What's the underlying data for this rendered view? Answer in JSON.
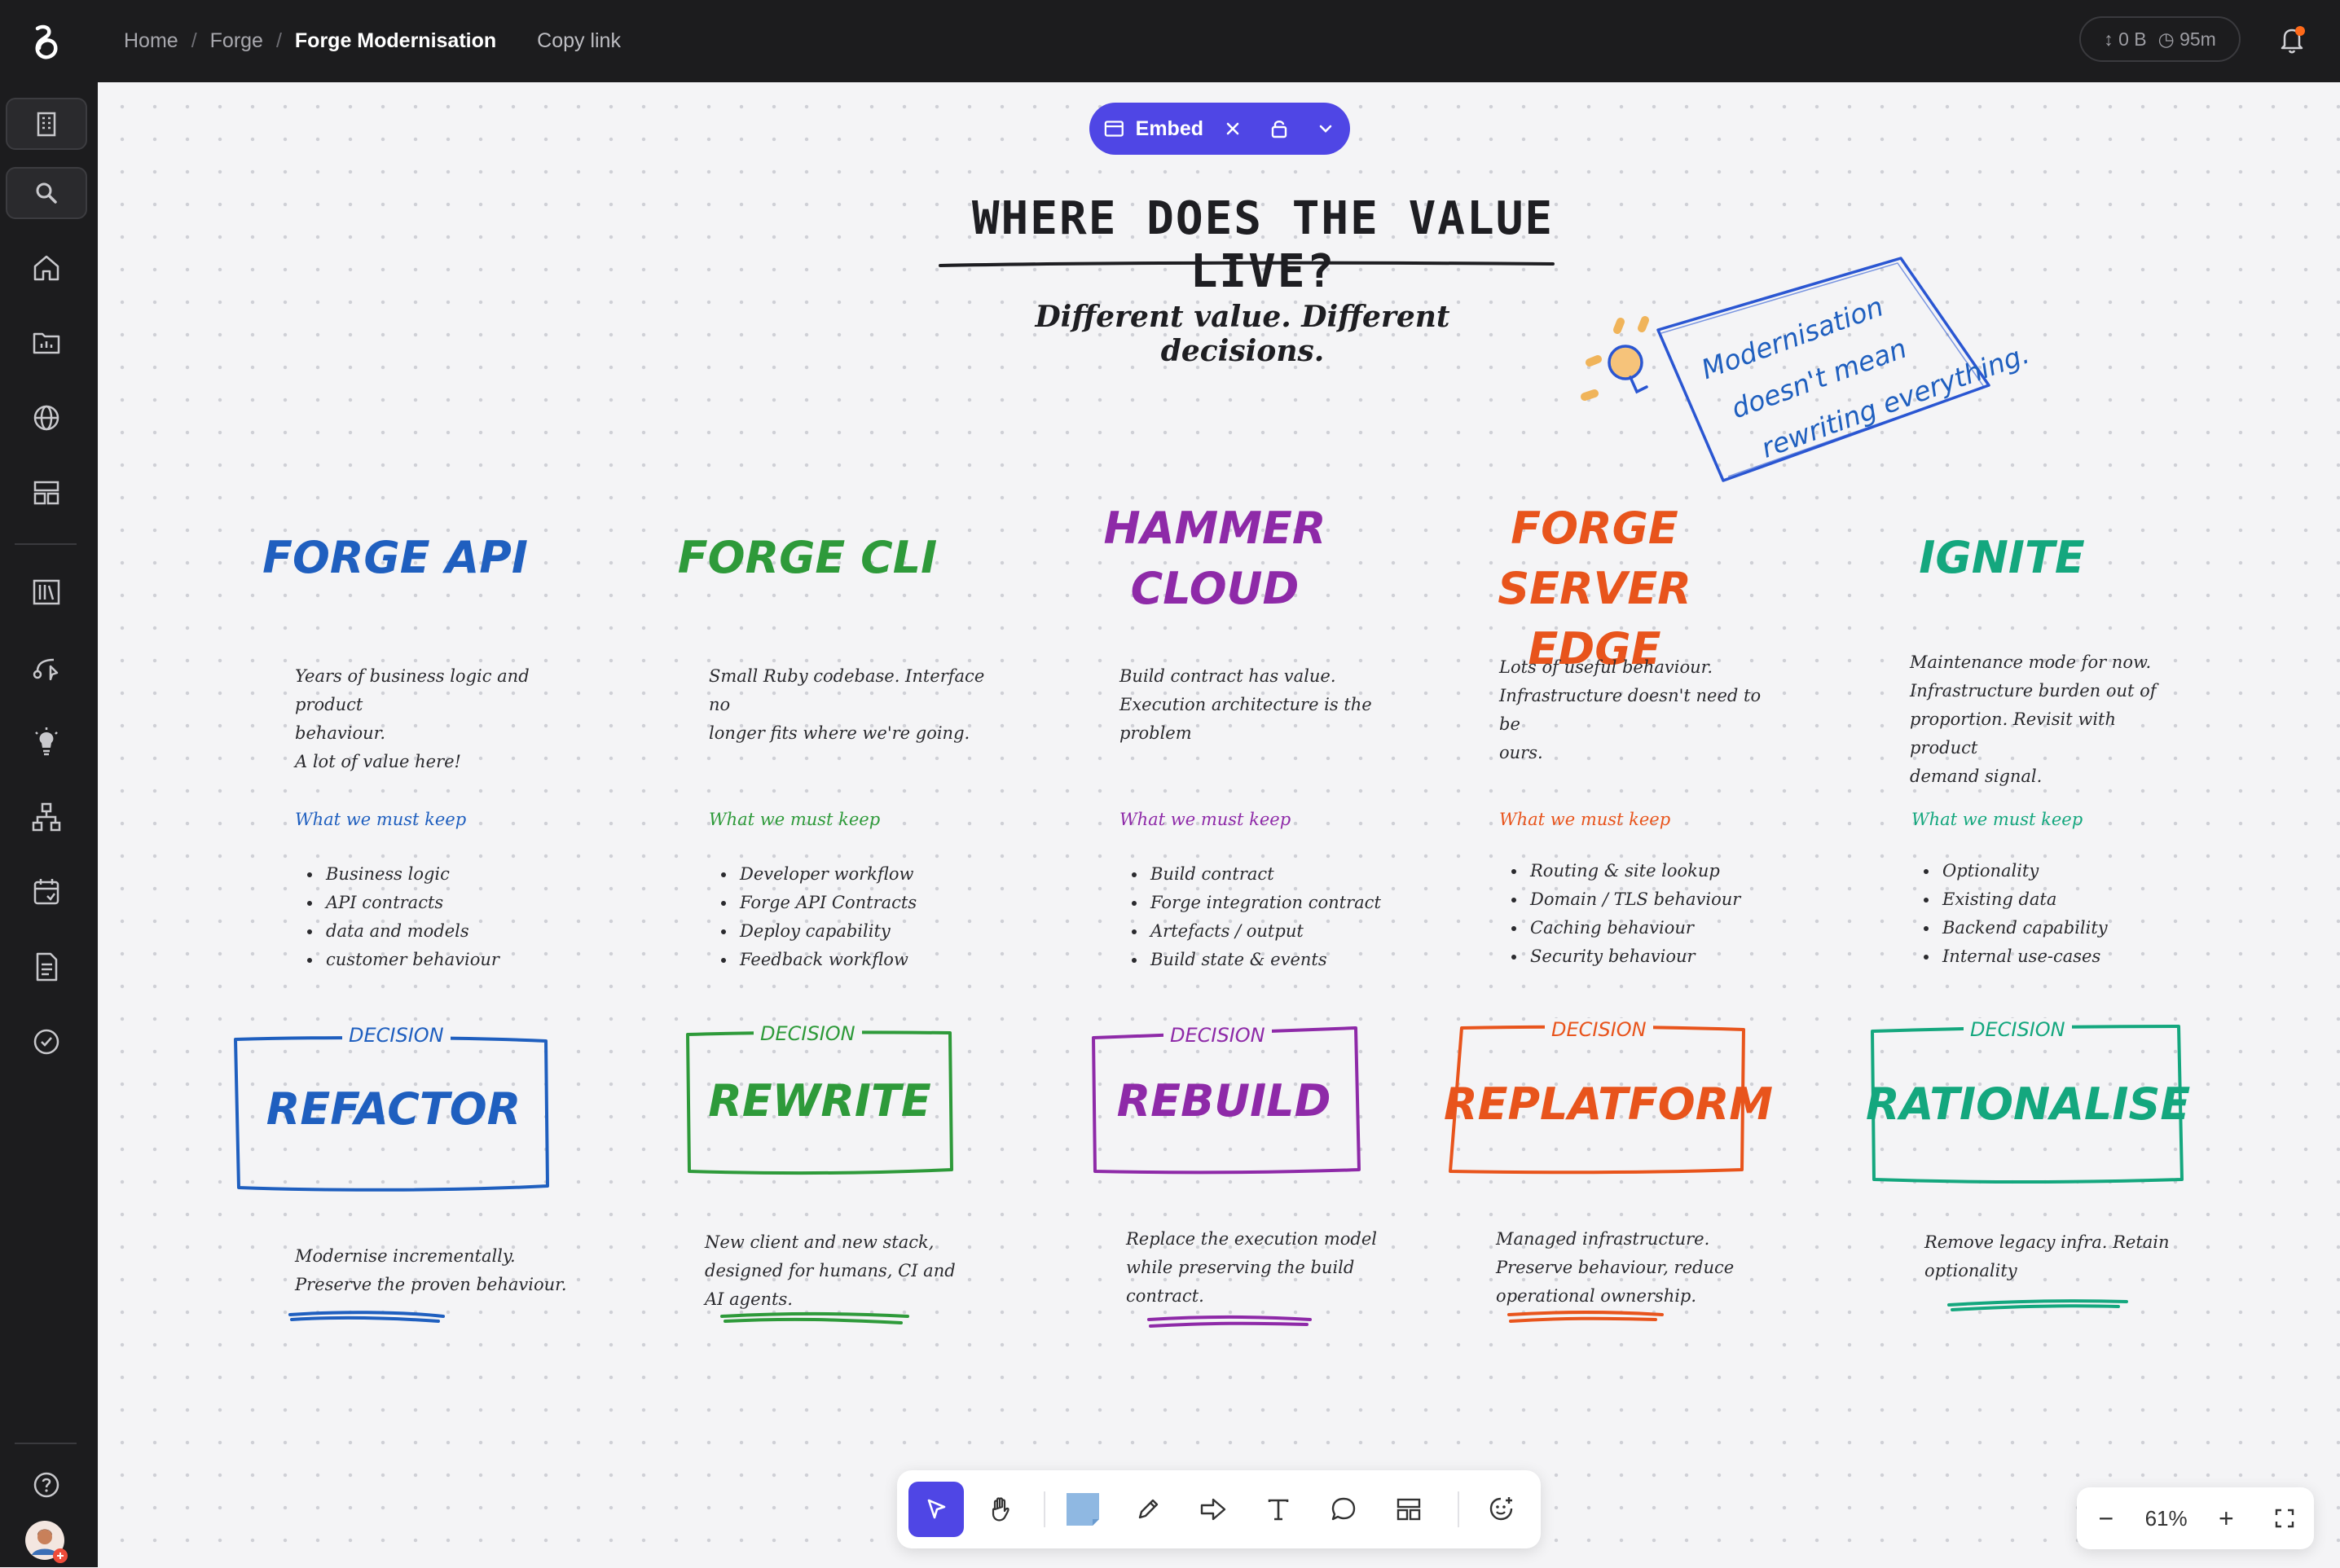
{
  "breadcrumb": {
    "home": "Home",
    "forge": "Forge",
    "current": "Forge Modernisation",
    "copy_link": "Copy link"
  },
  "stats": {
    "size": "0 B",
    "time": "95m"
  },
  "embed": {
    "label": "Embed"
  },
  "board": {
    "title": "WHERE DOES THE VALUE LIVE?",
    "subtitle": "Different value. Different decisions.",
    "note": [
      "Modernisation",
      "doesn't mean",
      "rewriting everything."
    ],
    "keep_label": "What we must keep",
    "decision_label": "DECISION"
  },
  "columns": [
    {
      "title": [
        "FORGE API"
      ],
      "color": "#1f5fbf",
      "desc": [
        "Years of business logic and product",
        "behaviour.",
        "A lot of value here!"
      ],
      "keep": [
        "Business logic",
        "API contracts",
        "data and models",
        "customer behaviour"
      ],
      "decision": "REFACTOR",
      "footer": [
        "Modernise incrementally.",
        "Preserve the proven behaviour."
      ]
    },
    {
      "title": [
        "FORGE CLI"
      ],
      "color": "#2e9a3a",
      "desc": [
        "Small Ruby codebase. Interface no",
        "longer fits where we're going."
      ],
      "keep": [
        "Developer workflow",
        "Forge API Contracts",
        "Deploy capability",
        "Feedback workflow"
      ],
      "decision": "REWRITE",
      "footer": [
        "New client and new stack,",
        "designed for humans, CI and",
        "AI agents."
      ]
    },
    {
      "title": [
        "HAMMER",
        "CLOUD"
      ],
      "color": "#8e2aa8",
      "desc": [
        "Build contract has value.",
        "Execution architecture is the",
        "problem"
      ],
      "keep": [
        "Build contract",
        "Forge integration contract",
        "Artefacts / output",
        "Build state & events"
      ],
      "decision": "REBUILD",
      "footer": [
        "Replace the execution model",
        "while preserving the build",
        "contract."
      ]
    },
    {
      "title": [
        "FORGE",
        "SERVER EDGE"
      ],
      "color": "#e8541c",
      "desc": [
        "Lots of useful behaviour.",
        "Infrastructure doesn't need to be",
        "ours."
      ],
      "keep": [
        "Routing & site lookup",
        "Domain / TLS behaviour",
        "Caching behaviour",
        "Security behaviour"
      ],
      "decision": "REPLATFORM",
      "footer": [
        "Managed infrastructure.",
        "Preserve behaviour, reduce",
        "operational ownership."
      ]
    },
    {
      "title": [
        "IGNITE"
      ],
      "color": "#14a77e",
      "desc": [
        "Maintenance mode for now.",
        "Infrastructure burden out of",
        "proportion. Revisit with product",
        "demand signal."
      ],
      "keep": [
        "Optionality",
        "Existing data",
        "Backend capability",
        "Internal use-cases"
      ],
      "decision": "RATIONALISE",
      "footer": [
        "Remove legacy infra. Retain",
        "optionality"
      ]
    }
  ],
  "zoom": {
    "level": "61%",
    "minus": "−",
    "plus": "+"
  },
  "icons": {
    "sidebar": [
      "building-icon",
      "search-icon",
      "home-icon",
      "folder-icon",
      "globe-icon",
      "layout-icon",
      "library-icon",
      "route-icon",
      "lightbulb-icon",
      "hierarchy-icon",
      "calendar-icon",
      "document-icon",
      "check-circle-icon",
      "help-icon"
    ],
    "toolbar": [
      "select-pointer-icon",
      "hand-icon",
      "sticky-note-icon",
      "pen-icon",
      "arrow-icon",
      "text-icon",
      "comment-icon",
      "template-icon",
      "emoji-add-icon"
    ]
  }
}
